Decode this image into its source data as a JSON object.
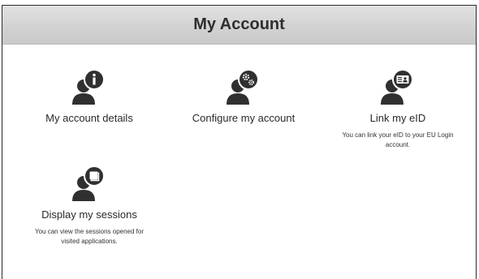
{
  "page": {
    "title": "My Account"
  },
  "tiles": [
    {
      "title": "My account details",
      "description": "",
      "icon": "user-info-icon"
    },
    {
      "title": "Configure my account",
      "description": "",
      "icon": "user-settings-icon"
    },
    {
      "title": "Link my eID",
      "description": "You can link your eID to your EU Login account.",
      "icon": "user-eid-card-icon"
    },
    {
      "title": "Display my sessions",
      "description": "You can view the sessions opened for visited applications.",
      "icon": "user-sessions-icon"
    }
  ],
  "colors": {
    "icon": "#303030",
    "header_bg": "#d2d2d2",
    "text": "#2a2a2a"
  }
}
